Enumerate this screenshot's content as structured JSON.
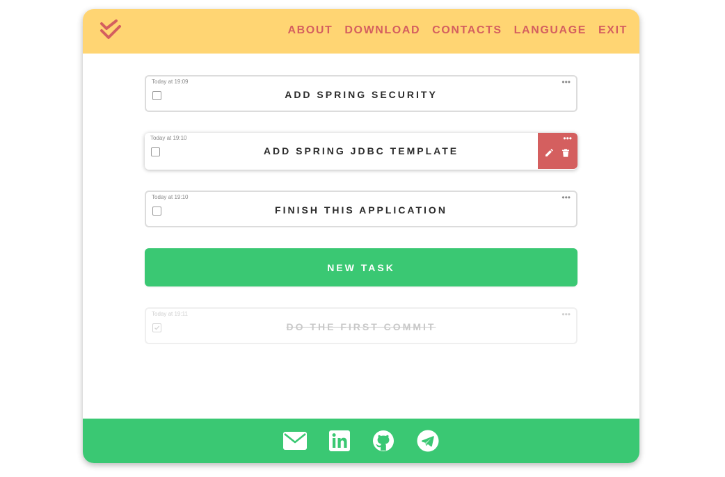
{
  "colors": {
    "header": "#ffd573",
    "accent": "#d45f5f",
    "green": "#3ac873",
    "text": "#2b2b2b"
  },
  "header": {
    "logo_icon": "double-check-icon",
    "nav": [
      {
        "label": "ABOUT"
      },
      {
        "label": "DOWNLOAD"
      },
      {
        "label": "CONTACTS"
      },
      {
        "label": "LANGUAGE"
      },
      {
        "label": "EXIT"
      }
    ]
  },
  "tasks": [
    {
      "time": "Today at 19:09",
      "title": "ADD SPRING SECURITY",
      "done": false,
      "menu": "•••"
    },
    {
      "time": "Today at 19:10",
      "title": "ADD SPRING JDBC TEMPLATE",
      "done": false,
      "menu": "•••",
      "actions": [
        "edit-icon",
        "trash-icon"
      ]
    },
    {
      "time": "Today at 19:10",
      "title": "FINISH THIS APPLICATION",
      "done": false,
      "menu": "•••"
    }
  ],
  "new_task_label": "NEW TASK",
  "done_tasks": [
    {
      "time": "Today at 19:11",
      "title": "DO THE FIRST COMMIT",
      "done": true,
      "menu": "•••"
    }
  ],
  "footer": {
    "links": [
      "email-icon",
      "linkedin-icon",
      "github-icon",
      "telegram-icon"
    ]
  }
}
